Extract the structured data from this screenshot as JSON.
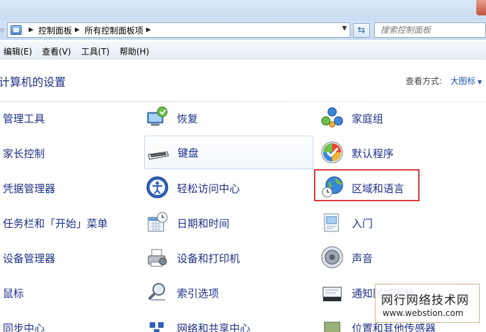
{
  "address_bar": {
    "crumbs": [
      "控制面板",
      "所有控制面板项"
    ],
    "search_placeholder": "搜索控制面板"
  },
  "menu": [
    "编辑(E)",
    "查看(V)",
    "工具(T)",
    "帮助(H)"
  ],
  "header": {
    "title": "计算机的设置",
    "view_label": "查看方式:",
    "view_value": "大图标"
  },
  "column1": [
    "管理工具",
    "家长控制",
    "凭据管理器",
    "任务栏和「开始」菜单",
    "设备管理器",
    "鼠标",
    "同步中心"
  ],
  "column2": [
    "恢复",
    "键盘",
    "轻松访问中心",
    "日期和时间",
    "设备和打印机",
    "索引选项",
    "网络和共享中心"
  ],
  "column3": [
    "家庭组",
    "默认程序",
    "区域和语言",
    "入门",
    "声音",
    "通知区域图标",
    "位置和其他传感器"
  ],
  "watermark": {
    "line1": "网行网络技术网",
    "line2": "www.webstion.com"
  },
  "colors": {
    "link": "#1e3287",
    "highlight_border": "#d93a3a"
  }
}
